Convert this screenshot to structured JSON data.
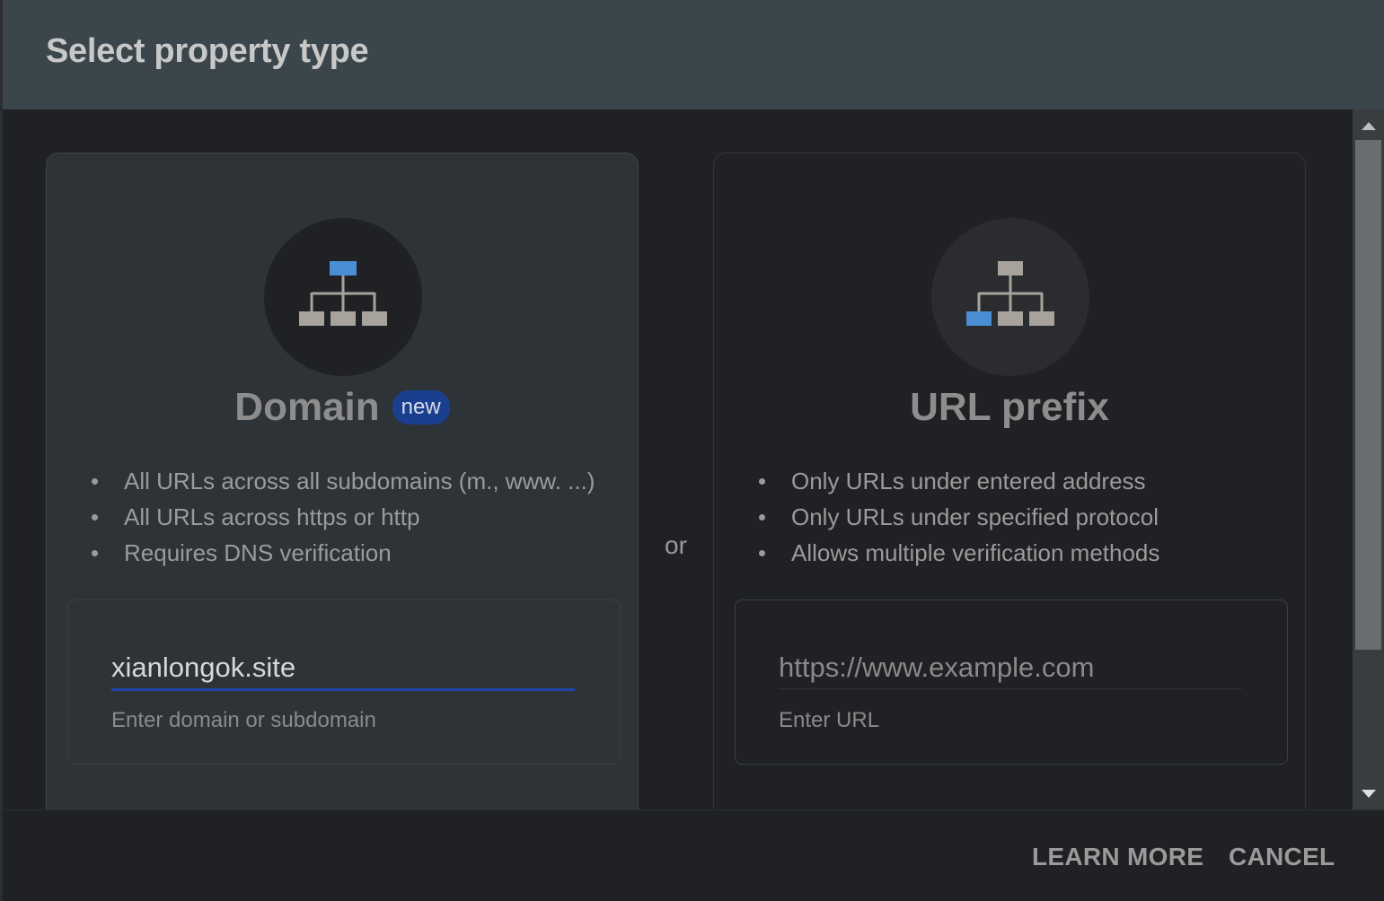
{
  "dialog": {
    "title": "Select property type"
  },
  "domain_card": {
    "title": "Domain",
    "badge": "new",
    "features": [
      "All URLs across all subdomains (m., www. ...)",
      "All URLs across https or http",
      "Requires DNS verification"
    ],
    "input_value": "xianlongok.site",
    "helper_text": "Enter domain or subdomain",
    "icon": "sitemap-root-highlighted-icon"
  },
  "separator": {
    "label": "or"
  },
  "url_prefix_card": {
    "title": "URL prefix",
    "features": [
      "Only URLs under entered address",
      "Only URLs under specified protocol",
      "Allows multiple verification methods"
    ],
    "input_value": "",
    "input_placeholder": "https://www.example.com",
    "helper_text": "Enter URL",
    "icon": "sitemap-leaf-highlighted-icon"
  },
  "footer": {
    "learn_more_label": "LEARN MORE",
    "cancel_label": "CANCEL"
  },
  "colors": {
    "header_bg": "#3a454c",
    "accent_blue": "#4a8fd4",
    "badge_bg": "#1b3f8f",
    "underline_active": "#1e47a8"
  }
}
